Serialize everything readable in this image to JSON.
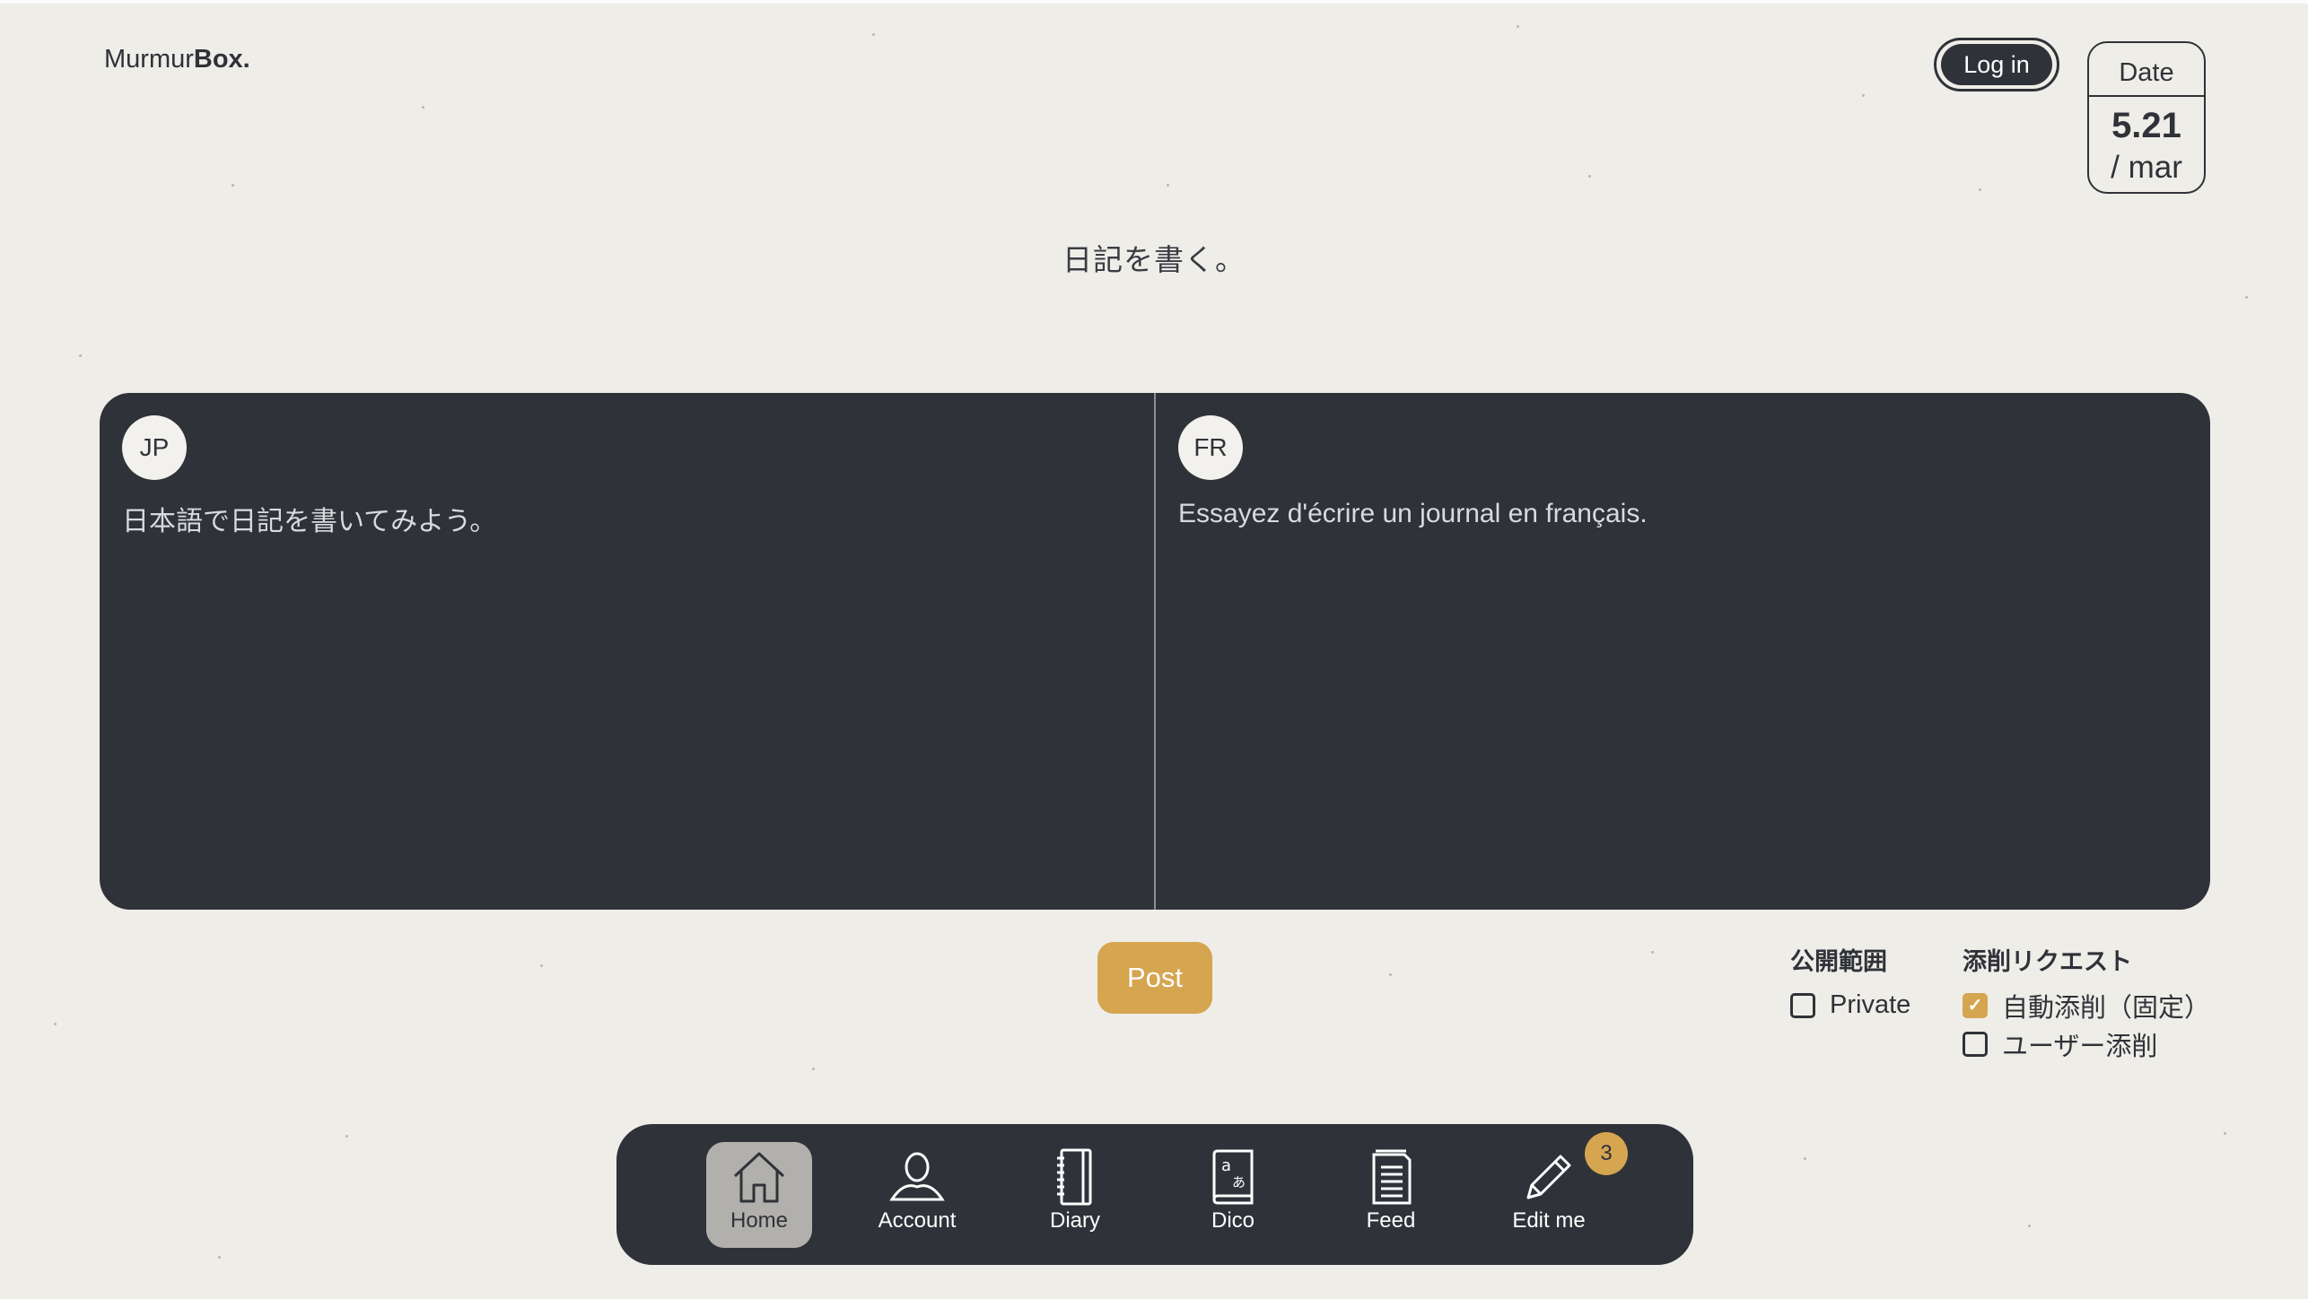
{
  "app": {
    "logo_regular": "Murmur",
    "logo_bold": "Box."
  },
  "header": {
    "login_label": "Log in",
    "date": {
      "label": "Date",
      "day": "5.21",
      "weekday": "/ mar"
    }
  },
  "headline": "日記を書く。",
  "editor": {
    "left": {
      "lang": "JP",
      "placeholder": "日本語で日記を書いてみよう。"
    },
    "right": {
      "lang": "FR",
      "placeholder": "Essayez d'écrire un journal en français."
    }
  },
  "post_label": "Post",
  "options": {
    "visibility": {
      "title": "公開範囲",
      "items": [
        {
          "label": "Private",
          "checked": false
        }
      ]
    },
    "correction": {
      "title": "添削リクエスト",
      "items": [
        {
          "label": "自動添削（固定）",
          "checked": true
        },
        {
          "label": "ユーザー添削",
          "checked": false
        }
      ]
    }
  },
  "nav": {
    "items": [
      {
        "label": "Home",
        "icon": "home-icon",
        "active": true
      },
      {
        "label": "Account",
        "icon": "user-icon",
        "active": false
      },
      {
        "label": "Diary",
        "icon": "notebook-icon",
        "active": false
      },
      {
        "label": "Dico",
        "icon": "dictionary-icon",
        "active": false
      },
      {
        "label": "Feed",
        "icon": "document-icon",
        "active": false
      },
      {
        "label": "Edit me",
        "icon": "pencil-icon",
        "active": false
      }
    ],
    "edit_badge": "3"
  },
  "colors": {
    "background": "#efede8",
    "panel": "#2f3238",
    "accent": "#d5a550"
  }
}
